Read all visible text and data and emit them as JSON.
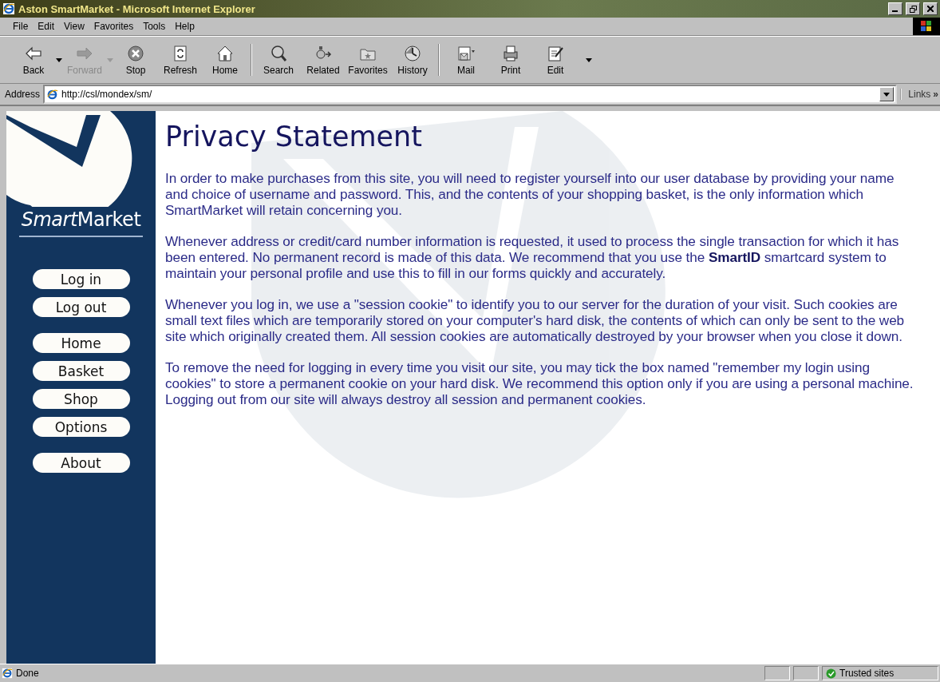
{
  "window": {
    "title": "Aston SmartMarket - Microsoft Internet Explorer"
  },
  "menu": [
    "File",
    "Edit",
    "View",
    "Favorites",
    "Tools",
    "Help"
  ],
  "toolbar": {
    "groups": [
      [
        {
          "label": "Back",
          "kind": "back",
          "disabled": false,
          "dropdown": true
        },
        {
          "label": "Forward",
          "kind": "forward",
          "disabled": true,
          "dropdown": true
        },
        {
          "label": "Stop",
          "kind": "stop",
          "disabled": false,
          "dropdown": false
        },
        {
          "label": "Refresh",
          "kind": "refresh",
          "disabled": false,
          "dropdown": false
        },
        {
          "label": "Home",
          "kind": "home",
          "disabled": false,
          "dropdown": false
        }
      ],
      [
        {
          "label": "Search",
          "kind": "search",
          "disabled": false,
          "dropdown": false
        },
        {
          "label": "Related",
          "kind": "related",
          "disabled": false,
          "dropdown": false
        },
        {
          "label": "Favorites",
          "kind": "favorites",
          "disabled": false,
          "dropdown": false
        },
        {
          "label": "History",
          "kind": "history",
          "disabled": false,
          "dropdown": false
        }
      ],
      [
        {
          "label": "Mail",
          "kind": "mail",
          "disabled": false,
          "dropdown": false
        },
        {
          "label": "Print",
          "kind": "print",
          "disabled": false,
          "dropdown": false
        },
        {
          "label": "Edit",
          "kind": "edit",
          "disabled": false,
          "dropdown": false
        }
      ]
    ]
  },
  "address": {
    "label": "Address",
    "value": "http://csl/mondex/sm/",
    "links": "Links",
    "links_more": "»"
  },
  "sidebar": {
    "logo": [
      {
        "text": "Smart",
        "italic": true
      },
      {
        "text": "Market",
        "italic": false
      }
    ],
    "nav_groups": [
      [
        "Log in",
        "Log out"
      ],
      [
        "Home",
        "Basket",
        "Shop",
        "Options"
      ],
      [
        "About"
      ]
    ]
  },
  "page": {
    "title": "Privacy Statement",
    "paragraphs": [
      "In order to make purchases from this site, you will need to register yourself into our user database by providing your name and choice of username and password. This, and the contents of your shopping basket, is the only information which SmartMarket will retain concerning you.",
      "Whenever address or credit/card number information is requested, it used to process the single transaction for which it has been entered. No permanent record is made of this data. We recommend that you use the **SmartID** smartcard system to maintain your personal profile and use this to fill in our forms quickly and accurately.",
      "Whenever you log in, we use a \"session cookie\" to identify you to our server for the duration of your visit. Such cookies are small text files which are temporarily stored on your computer's hard disk, the contents of which can only be sent to the web site which originally created them. All session cookies are automatically destroyed by your browser when you close it down.",
      "To remove the need for logging in every time you visit our site, you may tick the box named \"remember my login using cookies\" to store a permanent cookie on your hard disk. We recommend this option only if you are using a personal machine. Logging out from our site will always destroy all session and permanent cookies."
    ]
  },
  "status_bar": {
    "text": "Done",
    "zone": "Trusted sites"
  }
}
